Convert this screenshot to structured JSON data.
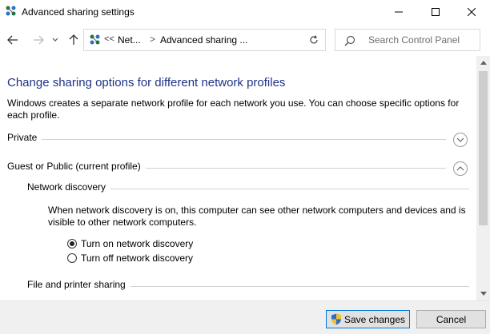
{
  "window": {
    "title": "Advanced sharing settings"
  },
  "address_bar": {
    "overflow": "<<",
    "crumbs": [
      "Net...",
      "Advanced sharing ..."
    ],
    "separator": ">"
  },
  "search": {
    "placeholder": "Search Control Panel"
  },
  "page": {
    "title": "Change sharing options for different network profiles",
    "description": "Windows creates a separate network profile for each network you use. You can choose specific options for each profile."
  },
  "profiles": [
    {
      "label": "Private",
      "expanded": false
    },
    {
      "label": "Guest or Public (current profile)",
      "expanded": true
    }
  ],
  "network_discovery": {
    "heading": "Network discovery",
    "description": "When network discovery is on, this computer can see other network computers and devices and is visible to other network computers.",
    "options": [
      {
        "label": "Turn on network discovery",
        "checked": true
      },
      {
        "label": "Turn off network discovery",
        "checked": false
      }
    ]
  },
  "file_printer_sharing": {
    "heading": "File and printer sharing"
  },
  "footer": {
    "save_label": "Save changes",
    "cancel_label": "Cancel"
  },
  "colors": {
    "title_blue": "#1e3287",
    "focus_blue": "#0078d7"
  }
}
